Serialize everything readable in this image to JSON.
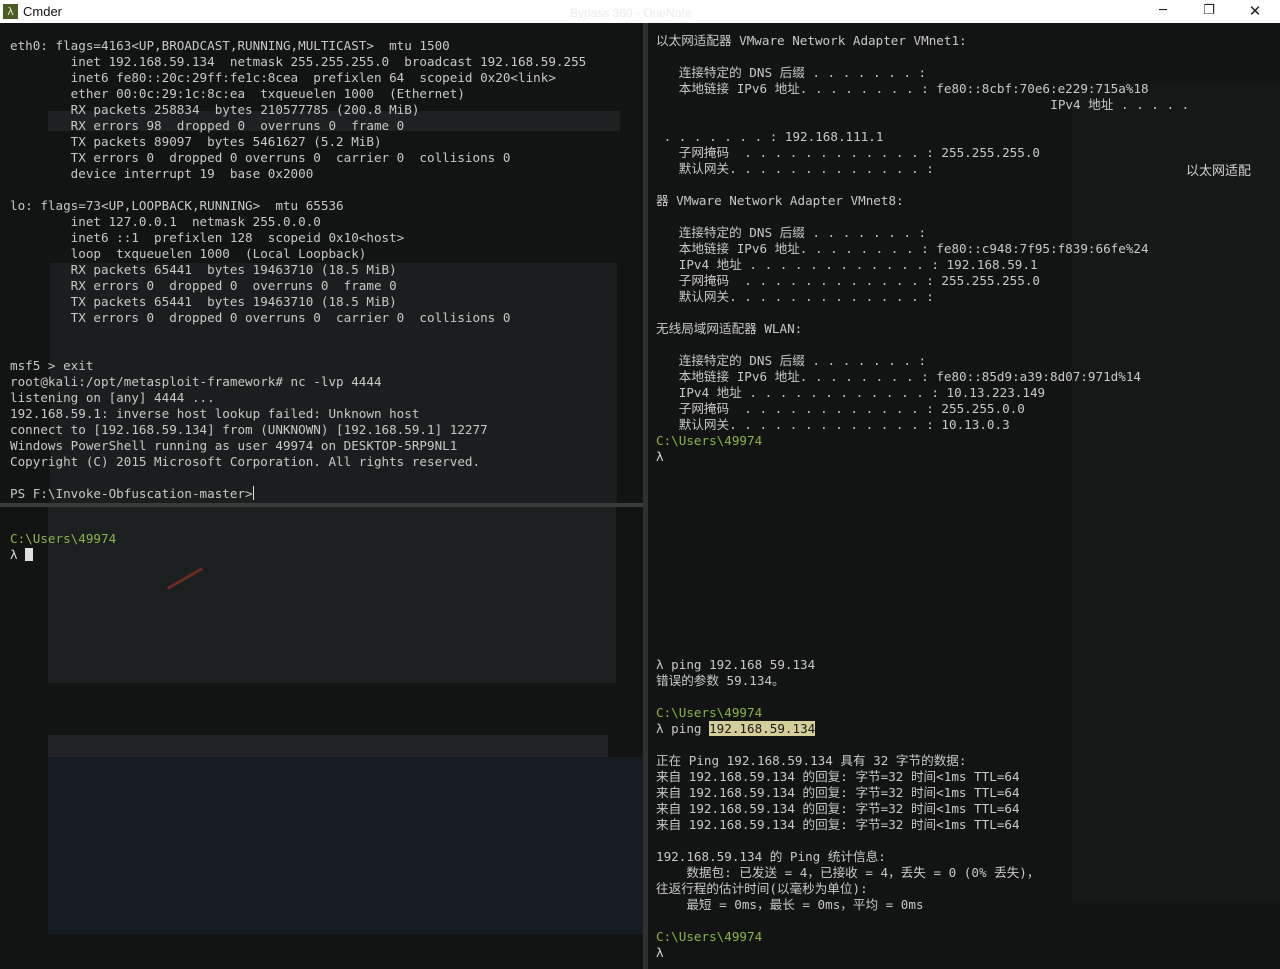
{
  "titlebar": {
    "app_name": "Cmder",
    "logo": "λ",
    "background_title": "Bypass 360 - OneNote",
    "minimize": "─",
    "maximize": "❐",
    "close": "✕"
  },
  "top_left": {
    "lines": [
      "eth0: flags=4163<UP,BROADCAST,RUNNING,MULTICAST>  mtu 1500",
      "        inet 192.168.59.134  netmask 255.255.255.0  broadcast 192.168.59.255",
      "        inet6 fe80::20c:29ff:fe1c:8cea  prefixlen 64  scopeid 0x20<link>",
      "        ether 00:0c:29:1c:8c:ea  txqueuelen 1000  (Ethernet)",
      "        RX packets 258834  bytes 210577785 (200.8 MiB)",
      "        RX errors 98  dropped 0  overruns 0  frame 0",
      "        TX packets 89097  bytes 5461627 (5.2 MiB)",
      "        TX errors 0  dropped 0 overruns 0  carrier 0  collisions 0",
      "        device interrupt 19  base 0x2000",
      "",
      "lo: flags=73<UP,LOOPBACK,RUNNING>  mtu 65536",
      "        inet 127.0.0.1  netmask 255.0.0.0",
      "        inet6 ::1  prefixlen 128  scopeid 0x10<host>",
      "        loop  txqueuelen 1000  (Local Loopback)",
      "        RX packets 65441  bytes 19463710 (18.5 MiB)",
      "        RX errors 0  dropped 0  overruns 0  frame 0",
      "        TX packets 65441  bytes 19463710 (18.5 MiB)",
      "        TX errors 0  dropped 0 overruns 0  carrier 0  collisions 0",
      "",
      "",
      "msf5 > exit",
      "root@kali:/opt/metasploit-framework# nc -lvp 4444",
      "listening on [any] 4444 ...",
      "192.168.59.1: inverse host lookup failed: Unknown host",
      "connect to [192.168.59.134] from (UNKNOWN) [192.168.59.1] 12277",
      "Windows PowerShell running as user 49974 on DESKTOP-5RP9NL1",
      "Copyright (C) 2015 Microsoft Corporation. All rights reserved.",
      ""
    ],
    "ps_prompt": "PS F:\\Invoke-Obfuscation-master>"
  },
  "bottom_left": {
    "path": "C:\\Users\\49974",
    "lambda": "λ"
  },
  "right": {
    "block1": [
      "以太网适配器 VMware Network Adapter VMnet1:",
      "",
      "   连接特定的 DNS 后缀 . . . . . . . :",
      "   本地链接 IPv6 地址. . . . . . . . : fe80::8cbf:70e6:e229:715a%18",
      "                                                    IPv4 地址 . . . . .",
      "",
      " . . . . . . . : 192.168.111.1",
      "   子网掩码  . . . . . . . . . . . . : 255.255.255.0",
      "   默认网关. . . . . . . . . . . . . :",
      "",
      "器 VMware Network Adapter VMnet8:",
      "",
      "   连接特定的 DNS 后缀 . . . . . . . :",
      "   本地链接 IPv6 地址. . . . . . . . : fe80::c948:7f95:f839:66fe%24",
      "   IPv4 地址 . . . . . . . . . . . . : 192.168.59.1",
      "   子网掩码  . . . . . . . . . . . . : 255.255.255.0",
      "   默认网关. . . . . . . . . . . . . :",
      "",
      "无线局域网适配器 WLAN:",
      "",
      "   连接特定的 DNS 后缀 . . . . . . . :",
      "   本地链接 IPv6 地址. . . . . . . . : fe80::85d9:a39:8d07:971d%14",
      "   IPv4 地址 . . . . . . . . . . . . : 10.13.223.149",
      "   子网掩码  . . . . . . . . . . . . : 255.255.0.0",
      "   默认网关. . . . . . . . . . . . . : 10.13.0.3"
    ],
    "prompt1_path": "C:\\Users\\49974",
    "prompt1_lambda": "λ",
    "ping_err_cmd": "λ ping 192.168 59.134",
    "ping_err_msg": "错误的参数 59.134。",
    "prompt2_path": "C:\\Users\\49974",
    "ping_cmd_prefix": "λ ping ",
    "ping_cmd_target": "192.168.59.134",
    "ping_results": [
      "正在 Ping 192.168.59.134 具有 32 字节的数据:",
      "来自 192.168.59.134 的回复: 字节=32 时间<1ms TTL=64",
      "来自 192.168.59.134 的回复: 字节=32 时间<1ms TTL=64",
      "来自 192.168.59.134 的回复: 字节=32 时间<1ms TTL=64",
      "来自 192.168.59.134 的回复: 字节=32 时间<1ms TTL=64",
      "",
      "192.168.59.134 的 Ping 统计信息:",
      "    数据包: 已发送 = 4，已接收 = 4，丢失 = 0 (0% 丢失)，",
      "往返行程的估计时间(以毫秒为单位):",
      "    最短 = 0ms，最长 = 0ms，平均 = 0ms"
    ],
    "prompt3_path": "C:\\Users\\49974",
    "prompt3_lambda": "λ",
    "side_label": "以太网适配"
  },
  "colors": {
    "prompt_path": "#8ab34a",
    "terminal_text": "#c8c8c8",
    "terminal_bg": "#121414",
    "highlight": "#d4cf9a"
  }
}
